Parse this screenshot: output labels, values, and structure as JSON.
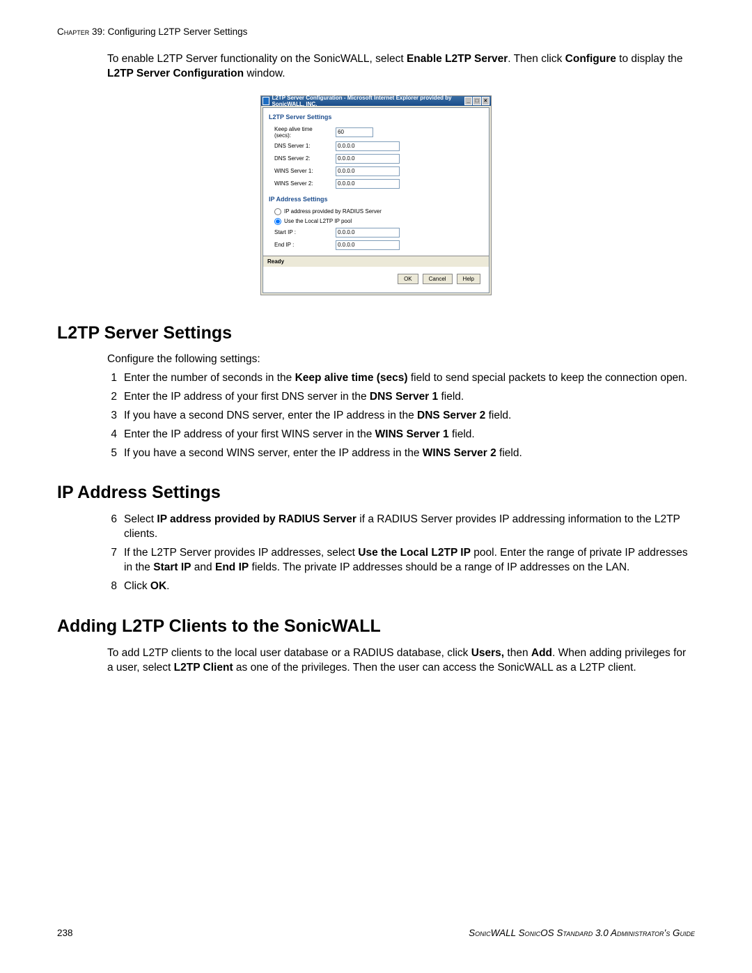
{
  "header": {
    "chapter_label": "Chapter",
    "chapter_num": "39:",
    "chapter_title": "Configuring L2TP Server Settings"
  },
  "intro": {
    "text_a": "To enable L2TP Server functionality on the SonicWALL, select ",
    "b1": "Enable L2TP Server",
    "text_b": ". Then click ",
    "b2": "Configure",
    "text_c": " to display the ",
    "b3": "L2TP Server Configuration",
    "text_d": " window."
  },
  "dialog": {
    "title": "L2TP Server Configuration - Microsoft Internet Explorer provided by SonicWALL, INC.",
    "section1": "L2TP Server Settings",
    "keep_alive_label": "Keep alive time (secs):",
    "keep_alive_value": "60",
    "dns1_label": "DNS Server 1:",
    "dns1_value": "0.0.0.0",
    "dns2_label": "DNS Server 2:",
    "dns2_value": "0.0.0.0",
    "wins1_label": "WINS Server 1:",
    "wins1_value": "0.0.0.0",
    "wins2_label": "WINS Server 2:",
    "wins2_value": "0.0.0.0",
    "section2": "IP Address Settings",
    "radio1": "IP address provided by RADIUS Server",
    "radio2": "Use the Local L2TP IP pool",
    "startip_label": "Start IP :",
    "startip_value": "0.0.0.0",
    "endip_label": "End IP :",
    "endip_value": "0.0.0.0",
    "status": "Ready",
    "ok": "OK",
    "cancel": "Cancel",
    "help": "Help"
  },
  "s1": {
    "h": "L2TP Server Settings",
    "lead": "Configure the following settings:",
    "steps": [
      {
        "n": "1",
        "a": "Enter the number of seconds in the ",
        "b": "Keep alive time (secs)",
        "c": " field to send special packets to keep the connection open."
      },
      {
        "n": "2",
        "a": "Enter the IP address of your first DNS server in the ",
        "b": "DNS Server 1",
        "c": " field."
      },
      {
        "n": "3",
        "a": "If you have a second DNS server, enter the IP address in the ",
        "b": "DNS Server 2",
        "c": " field."
      },
      {
        "n": "4",
        "a": "Enter the IP address of your first WINS server in the ",
        "b": "WINS Server 1",
        "c": " field."
      },
      {
        "n": "5",
        "a": "If you have a second WINS server, enter the IP address in the ",
        "b": "WINS Server 2",
        "c": " field."
      }
    ]
  },
  "s2": {
    "h": "IP Address Settings",
    "steps": [
      {
        "n": "6",
        "a": "Select ",
        "b": "IP address provided by RADIUS Server",
        "c": " if a RADIUS Server provides IP addressing information to the L2TP clients."
      },
      {
        "n": "7",
        "a": "If the L2TP Server provides IP addresses, select ",
        "b": "Use the Local L2TP IP",
        "c": " pool. Enter the range of private IP addresses in the ",
        "d": "Start IP",
        "e": " and ",
        "f": "End IP",
        "g": " fields. The private IP addresses should be a range of IP addresses on the LAN."
      },
      {
        "n": "8",
        "a": "Click ",
        "b": "OK",
        "c": "."
      }
    ]
  },
  "s3": {
    "h": "Adding L2TP Clients to the SonicWALL",
    "p_a": "To add L2TP clients to the local user database or a RADIUS database, click ",
    "b1": "Users,",
    "p_b": " then ",
    "b2": "Add",
    "p_c": ". When adding privileges for a user, select ",
    "b3": "L2TP Client",
    "p_d": " as one of the privileges. Then the user can access the SonicWALL as a L2TP client."
  },
  "footer": {
    "page": "238",
    "book": "SonicWALL SonicOS Standard 3.0 Administrator's Guide"
  }
}
